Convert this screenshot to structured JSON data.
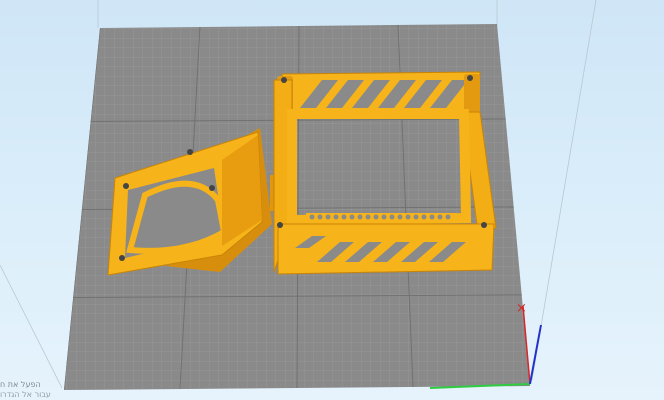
{
  "viewport": {
    "background": "#d6ebf8",
    "build_plate": {
      "color": "#8a8a8a",
      "grid_color": "#a6a6a6"
    },
    "model_color": "#f5b31a",
    "model_shade": "#d58d0b",
    "objects": [
      {
        "name": "fan-duct"
      },
      {
        "name": "case-frame"
      }
    ],
    "axes": {
      "x_color": "#2ecc40",
      "y_color": "#d62828",
      "z_color": "#2233cc"
    }
  },
  "watermark": {
    "line1": "הפעל את ח",
    "line2": "עבור אל הגדרו"
  }
}
